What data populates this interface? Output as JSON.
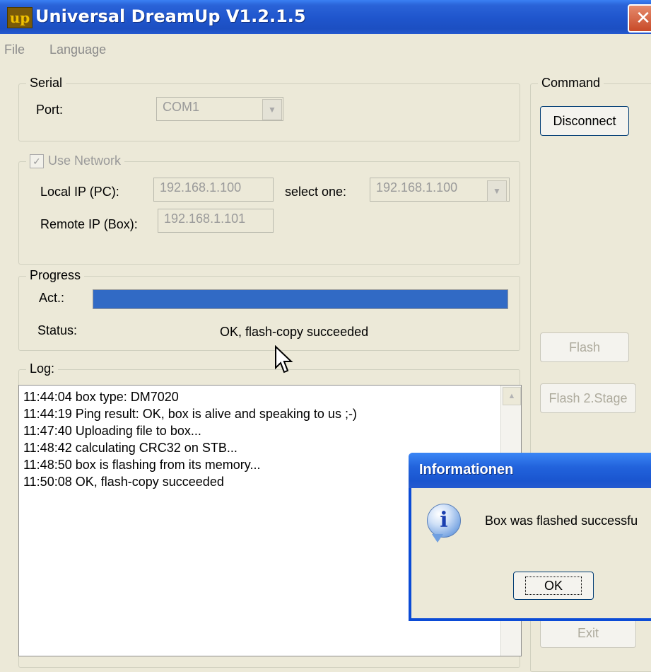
{
  "window": {
    "icon_text": "up",
    "title": "Universal DreamUp V1.2.1.5",
    "close_glyph": "✕"
  },
  "menu": {
    "items": [
      "File",
      "Language"
    ]
  },
  "serial": {
    "legend": "Serial",
    "port_label": "Port:",
    "port_value": "COM1"
  },
  "network": {
    "checkbox_label": "Use Network",
    "checked": true,
    "local_ip_label": "Local IP (PC):",
    "local_ip_value": "192.168.1.100",
    "select_label": "select one:",
    "select_value": "192.168.1.100",
    "remote_ip_label": "Remote IP (Box):",
    "remote_ip_value": "192.168.1.101"
  },
  "progress": {
    "legend": "Progress",
    "act_label": "Act.:",
    "act_fraction": 1.0,
    "status_label": "Status:",
    "status_value": "OK, flash-copy succeeded"
  },
  "log": {
    "legend": "Log:",
    "lines": [
      "11:44:04 box type: DM7020",
      "11:44:19 Ping result: OK, box is alive and speaking to us ;-)",
      "11:47:40 Uploading file to box...",
      "11:48:42 calculating CRC32 on STB...",
      "11:48:50 box is flashing from its memory...",
      "11:50:08 OK, flash-copy succeeded"
    ]
  },
  "command": {
    "legend": "Command",
    "disconnect_label": "Disconnect",
    "flash_label": "Flash",
    "flash2_label": "Flash 2.Stage",
    "exit_label": "Exit"
  },
  "dialog": {
    "title": "Informationen",
    "message": "Box was flashed successfu",
    "ok_label": "OK",
    "icon": "information-icon"
  },
  "colors": {
    "titlebar": "#1f55cc",
    "progress_fill": "#316ac5",
    "dialog_frame": "#0b4bd6",
    "window_bg": "#ece9d8"
  }
}
